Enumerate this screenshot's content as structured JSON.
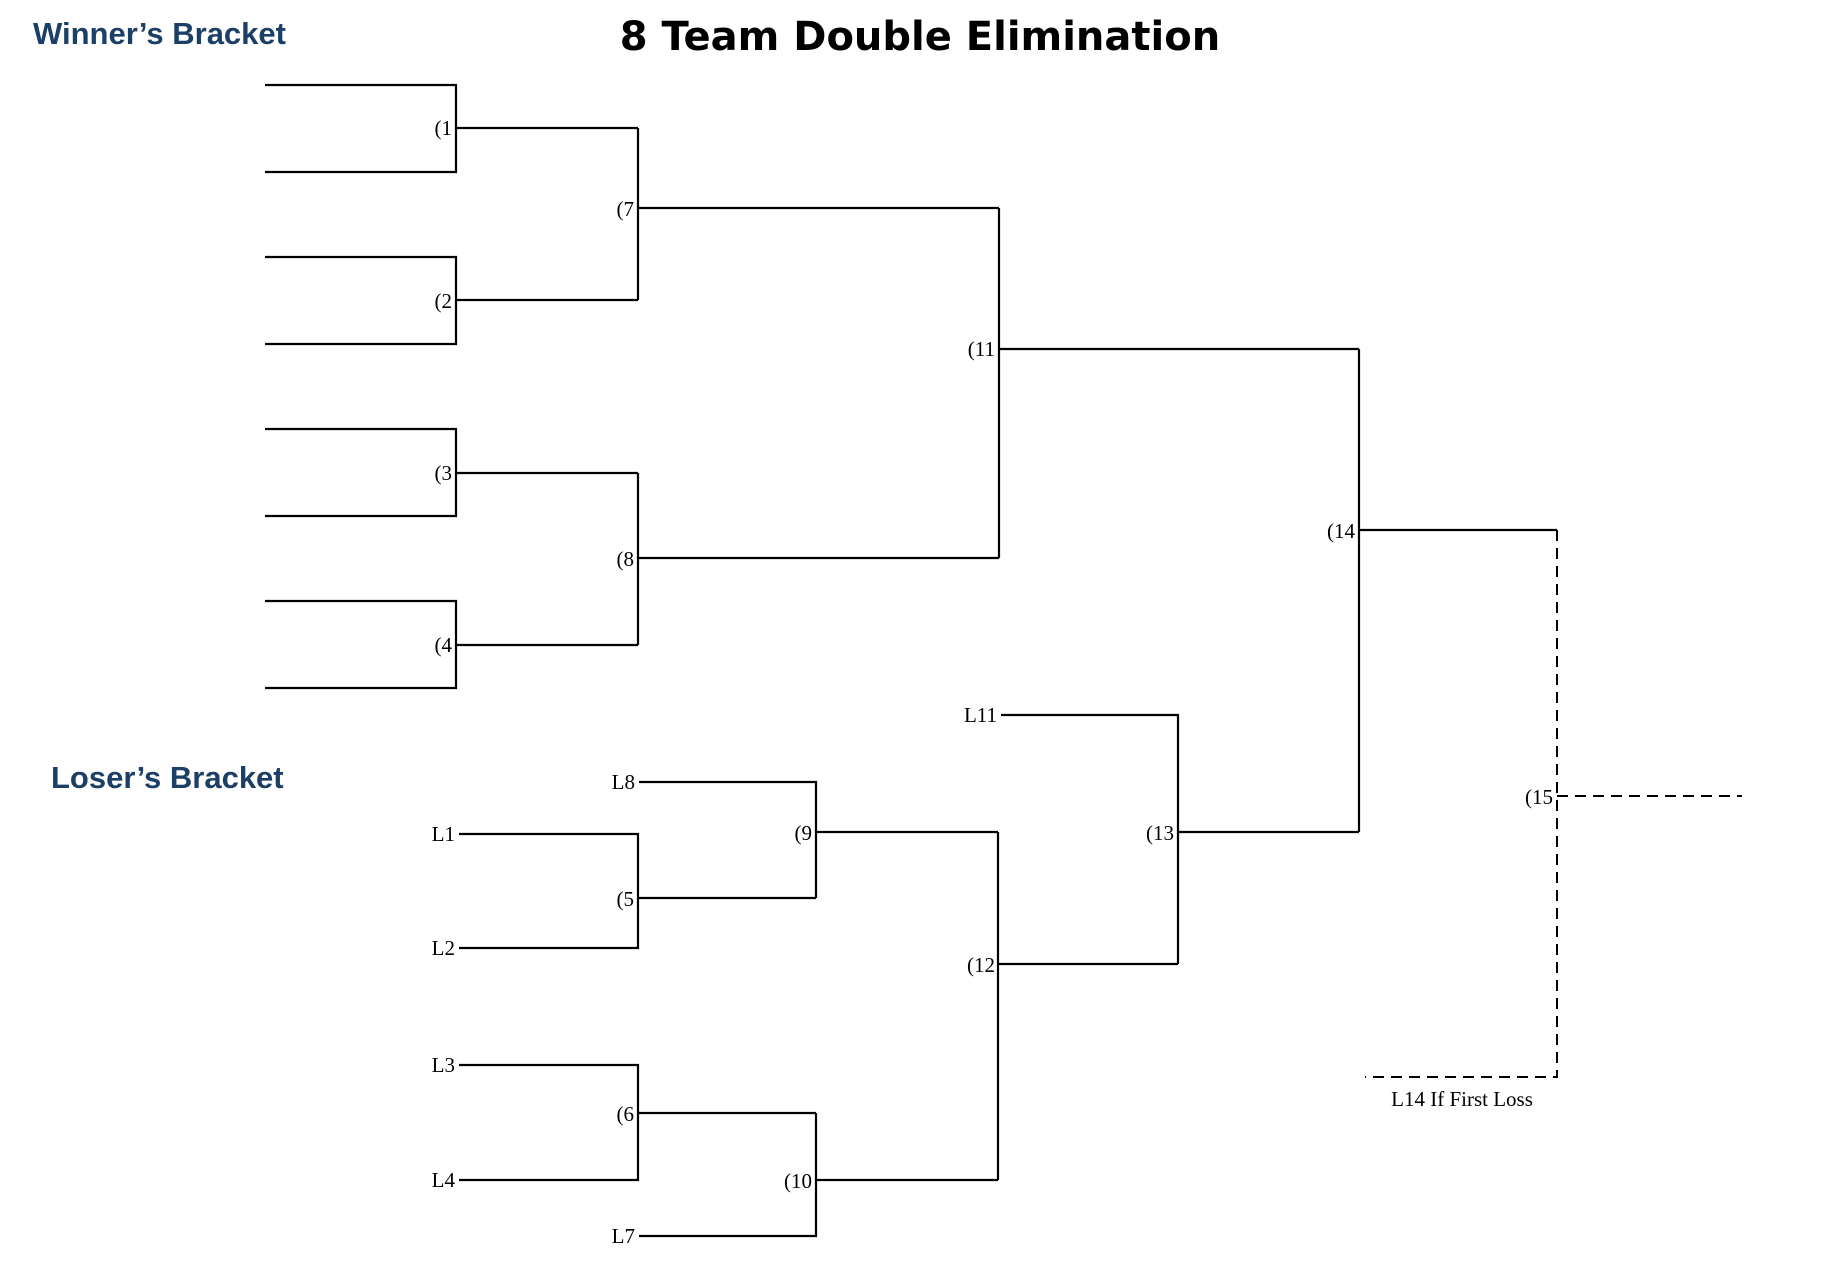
{
  "title": "8 Team Double Elimination",
  "winners_label": "Winner’s Bracket",
  "losers_label": "Loser’s Bracket",
  "games": {
    "g1": "(1",
    "g2": "(2",
    "g3": "(3",
    "g4": "(4",
    "g5": "(5",
    "g6": "(6",
    "g7": "(7",
    "g8": "(8",
    "g9": "(9",
    "g10": "(10",
    "g11": "(11",
    "g12": "(12",
    "g13": "(13",
    "g14": "(14",
    "g15": "(15"
  },
  "losers_entries": {
    "l1": "L1",
    "l2": "L2",
    "l3": "L3",
    "l4": "L4",
    "l7": "L7",
    "l8": "L8",
    "l11": "L11"
  },
  "if_first_loss": "L14 If First Loss"
}
